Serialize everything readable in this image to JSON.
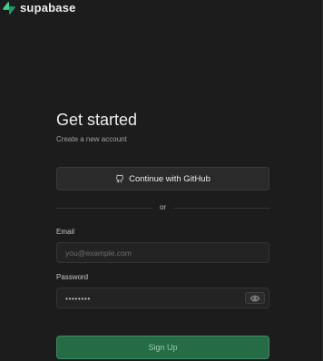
{
  "brand": {
    "name": "supabase",
    "logo_icon": "supabase-bolt-icon",
    "accent_color": "#3ecf8e"
  },
  "auth": {
    "title": "Get started",
    "subtitle": "Create a new account",
    "github_button": {
      "label": "Continue with GitHub",
      "icon": "github-icon"
    },
    "divider_text": "or",
    "email": {
      "label": "Email",
      "placeholder": "you@example.com",
      "value": ""
    },
    "password": {
      "label": "Password",
      "value": "••••••••",
      "toggle_icon": "eye-icon"
    },
    "signup_button": {
      "label": "Sign Up",
      "color": "#256b45"
    }
  }
}
